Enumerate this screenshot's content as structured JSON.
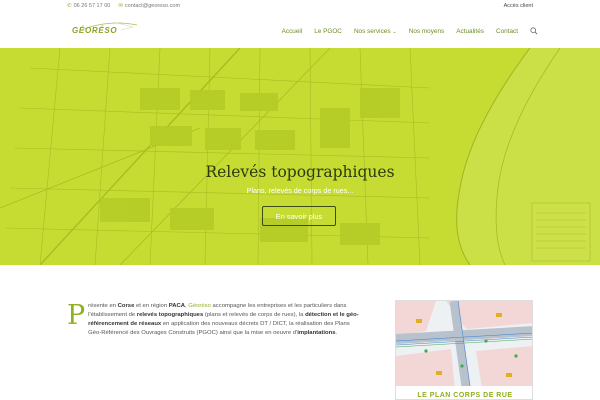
{
  "topbar": {
    "phone": "06 26 57 17 00",
    "email": "contact@georeso.com",
    "client_access": "Accès client"
  },
  "logo": {
    "text": "GÉORÉSO"
  },
  "nav": {
    "items": [
      "Accueil",
      "Le PGOC",
      "Nos services",
      "Nos moyens",
      "Actualités",
      "Contact"
    ]
  },
  "hero": {
    "title": "Relevés topographiques",
    "subtitle": "Plans, relevés de corps de rues...",
    "button": "En savoir plus"
  },
  "intro": {
    "dropcap": "P",
    "t1": "résente en ",
    "corse": "Corse",
    "t2": " et en région ",
    "paca": "PACA",
    "t3": ", ",
    "brand": "Géoréso",
    "t4": " accompagne les entreprises et les particuliers dans l'établissement de ",
    "releves": "relevés topographiques",
    "t5": " (plans et relevés de corps de rues), la ",
    "detection": "détection et le géo-référencement de réseaux",
    "t6": " en application des nouveaux décrets DT / DICT, la réalisation des Plans Géo-Référencé des Ouvrages Construits (PGOC) ainsi que la mise en oeuvre d'",
    "implantations": "implantations",
    "t7": "."
  },
  "card": {
    "caption": "LE PLAN CORPS DE RUE"
  },
  "colors": {
    "accent": "#8fb020",
    "hero_overlay": "#c2d92b",
    "nav": "#6a8f1f"
  },
  "icons": {
    "phone": "phone-icon",
    "email": "envelope-icon",
    "search": "search-icon",
    "chevron": "chevron-down-icon"
  }
}
